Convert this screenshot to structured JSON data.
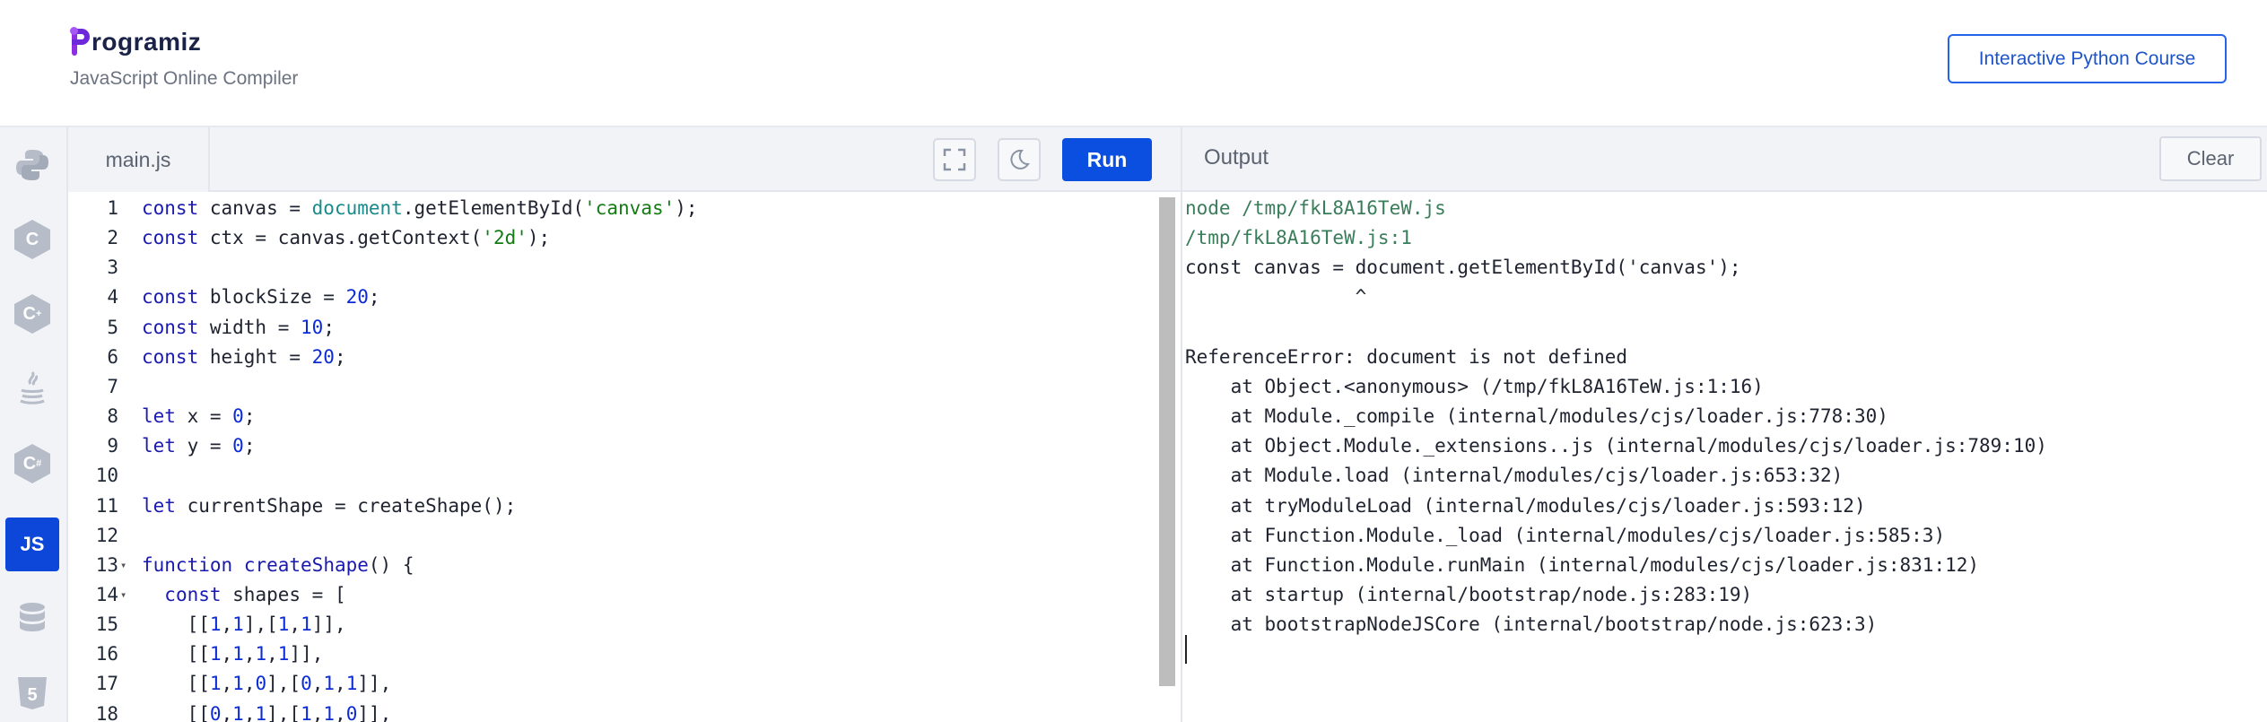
{
  "header": {
    "logo_text": "rogramiz",
    "subtitle": "JavaScript Online Compiler",
    "course_button": "Interactive Python Course"
  },
  "sidebar": {
    "items": [
      {
        "name": "python",
        "icon": "python-icon"
      },
      {
        "name": "c",
        "icon": "c-hex-icon",
        "label": "C"
      },
      {
        "name": "cpp",
        "icon": "cpp-hex-icon",
        "label": "C"
      },
      {
        "name": "java",
        "icon": "java-icon"
      },
      {
        "name": "csharp",
        "icon": "csharp-hex-icon",
        "label": "C"
      },
      {
        "name": "javascript",
        "icon": "js-icon",
        "label": "JS",
        "active": true
      },
      {
        "name": "sql",
        "icon": "database-icon"
      },
      {
        "name": "html",
        "icon": "html5-icon",
        "label": "5"
      }
    ]
  },
  "editor": {
    "tab_label": "main.js",
    "run_label": "Run",
    "accent": "#0b4fe0",
    "lines": [
      {
        "n": "1",
        "code": "const canvas = document.getElementById('canvas');"
      },
      {
        "n": "2",
        "code": "const ctx = canvas.getContext('2d');"
      },
      {
        "n": "3",
        "code": ""
      },
      {
        "n": "4",
        "code": "const blockSize = 20;"
      },
      {
        "n": "5",
        "code": "const width = 10;"
      },
      {
        "n": "6",
        "code": "const height = 20;"
      },
      {
        "n": "7",
        "code": ""
      },
      {
        "n": "8",
        "code": "let x = 0;"
      },
      {
        "n": "9",
        "code": "let y = 0;"
      },
      {
        "n": "10",
        "code": ""
      },
      {
        "n": "11",
        "code": "let currentShape = createShape();"
      },
      {
        "n": "12",
        "code": ""
      },
      {
        "n": "13",
        "code": "function createShape() {",
        "fold": true
      },
      {
        "n": "14",
        "code": "  const shapes = [",
        "fold": true
      },
      {
        "n": "15",
        "code": "    [[1,1],[1,1]],"
      },
      {
        "n": "16",
        "code": "    [[1,1,1,1]],"
      },
      {
        "n": "17",
        "code": "    [[1,1,0],[0,1,1]],"
      },
      {
        "n": "18",
        "code": "    [[0,1,1],[1,1,0]],"
      }
    ]
  },
  "output": {
    "title": "Output",
    "clear_label": "Clear",
    "lines": [
      {
        "text": "node /tmp/fkL8A16TeW.js",
        "style": "green"
      },
      {
        "text": "/tmp/fkL8A16TeW.js:1",
        "style": "green"
      },
      {
        "text": "const canvas = document.getElementById('canvas');",
        "style": "plain"
      },
      {
        "text": "               ^",
        "style": "plain"
      },
      {
        "text": "",
        "style": "plain"
      },
      {
        "text": "ReferenceError: document is not defined",
        "style": "plain"
      },
      {
        "text": "    at Object.<anonymous> (/tmp/fkL8A16TeW.js:1:16)",
        "style": "plain"
      },
      {
        "text": "    at Module._compile (internal/modules/cjs/loader.js:778:30)",
        "style": "plain"
      },
      {
        "text": "    at Object.Module._extensions..js (internal/modules/cjs/loader.js:789:10)",
        "style": "plain"
      },
      {
        "text": "    at Module.load (internal/modules/cjs/loader.js:653:32)",
        "style": "plain"
      },
      {
        "text": "    at tryModuleLoad (internal/modules/cjs/loader.js:593:12)",
        "style": "plain"
      },
      {
        "text": "    at Function.Module._load (internal/modules/cjs/loader.js:585:3)",
        "style": "plain"
      },
      {
        "text": "    at Function.Module.runMain (internal/modules/cjs/loader.js:831:12)",
        "style": "plain"
      },
      {
        "text": "    at startup (internal/bootstrap/node.js:283:19)",
        "style": "plain"
      },
      {
        "text": "    at bootstrapNodeJSCore (internal/bootstrap/node.js:623:3)",
        "style": "plain"
      }
    ]
  }
}
